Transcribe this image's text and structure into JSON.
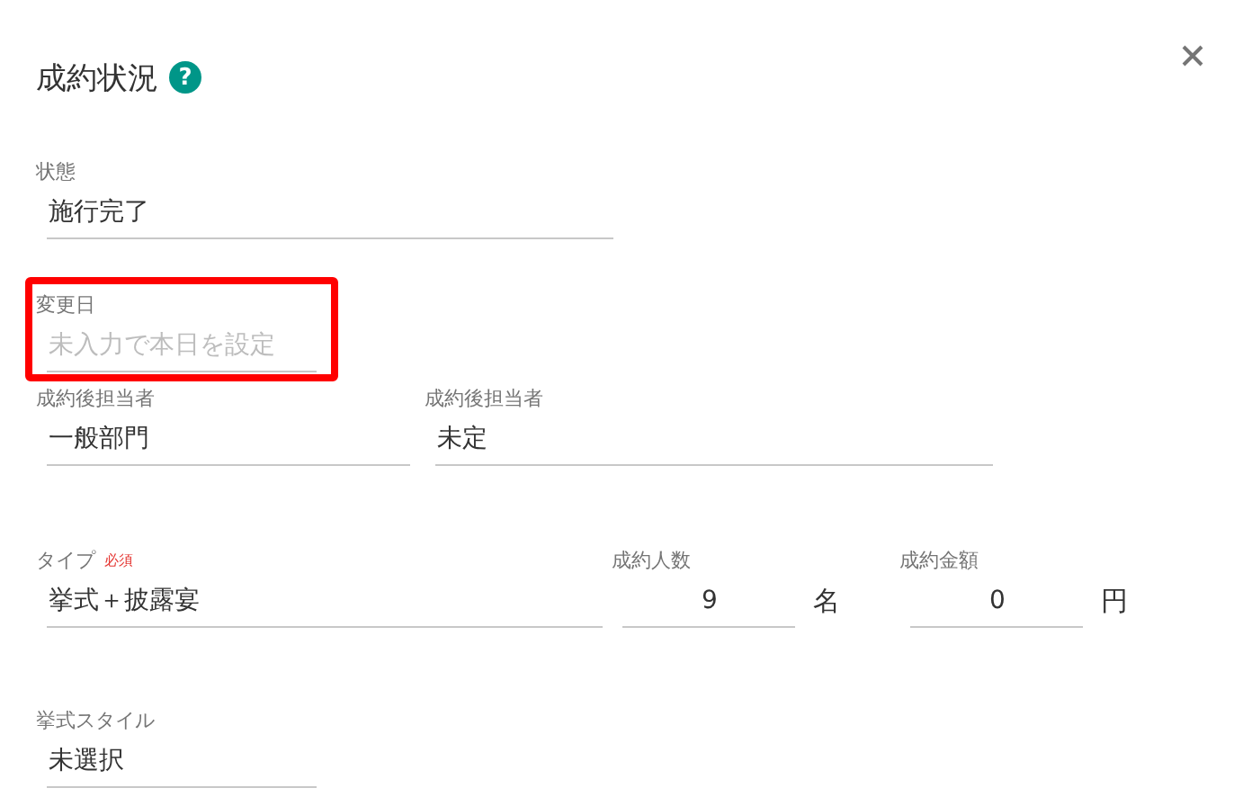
{
  "dialog": {
    "title": "成約状況",
    "help_glyph": "?",
    "rows": [
      {
        "fields": [
          {
            "kind": "text",
            "label": "状態",
            "value": "施行完了",
            "highlighted": false
          }
        ]
      },
      {
        "fields": [
          {
            "kind": "text",
            "label": "変更日",
            "placeholder": "未入力で本日を設定",
            "highlighted": true
          }
        ]
      },
      {
        "fields": [
          {
            "kind": "text",
            "label": "成約後担当者",
            "value": "一般部門",
            "highlighted": false
          },
          {
            "kind": "text",
            "label": "成約後担当者",
            "value": "未定",
            "highlighted": false
          }
        ]
      },
      {
        "fields": [
          {
            "kind": "text",
            "label": "タイプ",
            "required_mark": "必須",
            "value": "挙式＋披露宴",
            "highlighted": false
          },
          {
            "kind": "number",
            "label": "成約人数",
            "value": "9",
            "unit": "名",
            "highlighted": false
          },
          {
            "kind": "number",
            "label": "成約金額",
            "value": "0",
            "unit": "円",
            "highlighted": false
          }
        ]
      },
      {
        "fields": [
          {
            "kind": "text",
            "label": "挙式スタイル",
            "value": "未選択",
            "highlighted": false
          }
        ]
      }
    ]
  }
}
